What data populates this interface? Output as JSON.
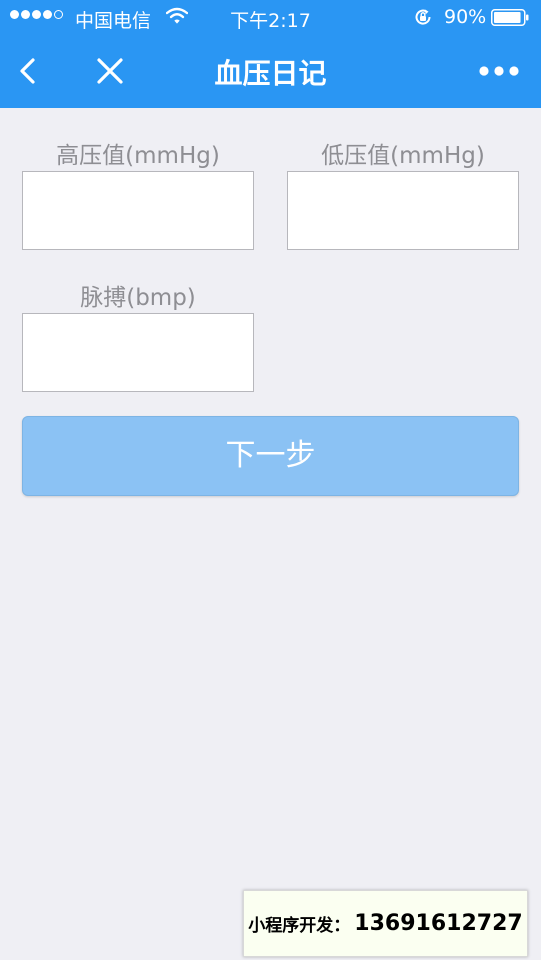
{
  "status_bar": {
    "carrier": "中国电信",
    "time": "下午2:17",
    "battery_percent": "90%",
    "signal_strength": 4,
    "signal_max": 5,
    "battery_level": 0.9,
    "icons": [
      "wifi-icon",
      "orientation-lock-icon",
      "battery-icon"
    ]
  },
  "nav": {
    "title": "血压日记",
    "icons": [
      "back-icon",
      "close-icon",
      "more-icon"
    ]
  },
  "form": {
    "systolic_label": "高压值(mmHg)",
    "systolic_value": "",
    "diastolic_label": "低压值(mmHg)",
    "diastolic_value": "",
    "pulse_label": "脉搏(bmp)",
    "pulse_value": "",
    "next_label": "下一步"
  },
  "contact": {
    "label": "小程序开发：",
    "phone": "13691612727"
  },
  "colors": {
    "header_blue": "#2a96f3",
    "button_blue": "#8bc2f4",
    "background": "#efeff4",
    "label_gray": "#8e8e93"
  }
}
